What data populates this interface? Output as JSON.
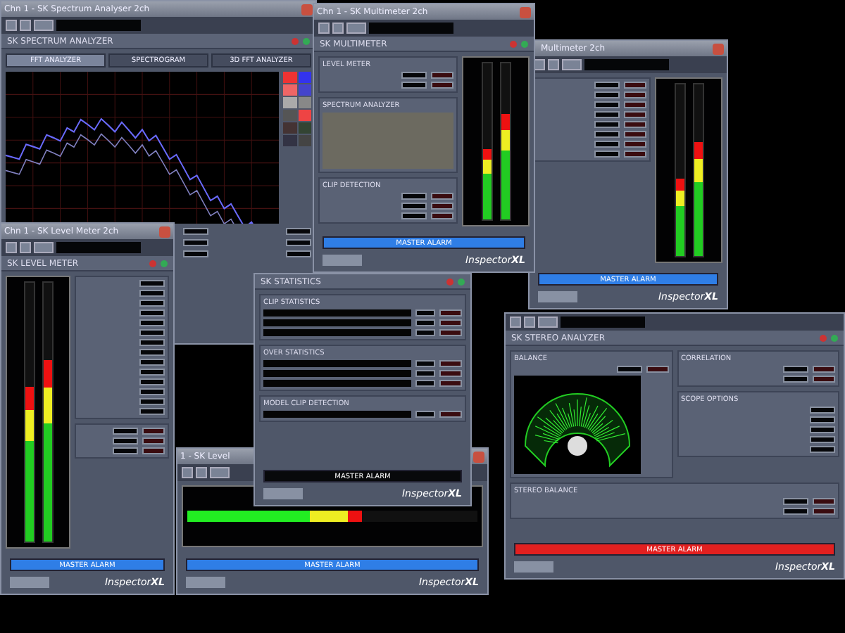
{
  "windows": [
    {
      "kind": "spectrum",
      "title": "Chn 1 - SK Spectrum Analyser 2ch",
      "header": "SK SPECTRUM ANALYZER",
      "tabs": [
        {
          "label": "FFT ANALYZER",
          "selected": true
        },
        {
          "label": "SPECTROGRAM",
          "selected": false
        },
        {
          "label": "3D FFT ANALYZER",
          "selected": false
        }
      ]
    },
    {
      "kind": "multimeter",
      "title": "Multimeter 2ch",
      "alarm": {
        "label": "MASTER ALARM",
        "color": "#2f7ee6"
      },
      "logo": "Inspector**XL**",
      "meters": [
        {
          "level": 0.45
        },
        {
          "level": 0.66
        }
      ]
    },
    {
      "kind": "hlevel",
      "title": "1 - SK Level",
      "alarm": {
        "label": "MASTER ALARM",
        "color": "#2f7ee6"
      },
      "logo": "Inspector**XL**",
      "meters": [
        {
          "level": 0.6
        }
      ]
    },
    {
      "kind": "stats",
      "header": "SK STATISTICS",
      "sections": [
        "CLIP STATISTICS",
        "OVER STATISTICS",
        "MODEL CLIP DETECTION"
      ],
      "alarm": {
        "label": "MASTER ALARM",
        "color": "#08090b"
      },
      "logo": "Inspector**XL**"
    },
    {
      "kind": "multimeter",
      "title": "Chn 1 - SK Multimeter 2ch",
      "header": "SK MULTIMETER",
      "sections": [
        "LEVEL METER",
        "SPECTRUM ANALYZER",
        "CLIP DETECTION"
      ],
      "alarm": {
        "label": "MASTER ALARM",
        "color": "#2f7ee6"
      },
      "logo": "Inspector**XL**",
      "meters": [
        {
          "level": 0.45
        },
        {
          "level": 0.68
        }
      ]
    },
    {
      "kind": "level",
      "title": "Chn 1 - SK Level Meter 2ch",
      "header": "SK LEVEL METER",
      "alarm": {
        "label": "MASTER ALARM",
        "color": "#2f7ee6"
      },
      "logo": "Inspector**XL**",
      "meters": [
        {
          "level": 0.6
        },
        {
          "level": 0.7
        }
      ]
    },
    {
      "kind": "stereo",
      "header": "SK STEREO ANALYZER",
      "sections": [
        "BALANCE",
        "CORRELATION",
        "SCOPE OPTIONS",
        "STEREO BALANCE"
      ],
      "alarm": {
        "label": "MASTER ALARM",
        "color": "#e22020"
      },
      "logo": "Inspector**XL**"
    }
  ]
}
